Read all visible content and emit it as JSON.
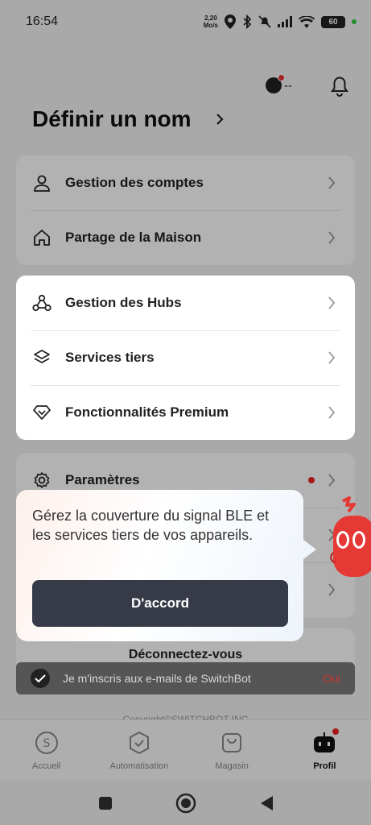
{
  "status_bar": {
    "time": "16:54",
    "speed_value": "2,20",
    "speed_unit": "Mo/s",
    "battery": "60"
  },
  "header": {
    "energy_value": "--"
  },
  "profile": {
    "name": "Définir un nom"
  },
  "card_account": [
    {
      "label": "Gestion des comptes",
      "icon": "user-icon"
    },
    {
      "label": "Partage de la Maison",
      "icon": "home-icon"
    }
  ],
  "card_services": [
    {
      "label": "Gestion des Hubs",
      "icon": "hub-icon"
    },
    {
      "label": "Services tiers",
      "icon": "layers-icon"
    },
    {
      "label": "Fonctionnalités Premium",
      "icon": "diamond-icon"
    }
  ],
  "card_settings": [
    {
      "label": "Paramètres",
      "icon": "gear-icon"
    }
  ],
  "logout": {
    "label": "Déconnectez-vous"
  },
  "email_banner": {
    "text": "Je m'inscris aux e-mails de SwitchBot",
    "action": "Oui"
  },
  "copyright": "Copyright©SWITCHBOT INC",
  "tooltip": {
    "message": "Gérez la couverture du signal BLE et les services tiers de vos appareils.",
    "button": "D'accord"
  },
  "tabs": [
    {
      "label": "Accueil",
      "icon": "home-s-icon",
      "active": false
    },
    {
      "label": "Automatisation",
      "icon": "automation-icon",
      "active": false
    },
    {
      "label": "Magasin",
      "icon": "shop-bag-icon",
      "active": false
    },
    {
      "label": "Profil",
      "icon": "robot-icon",
      "active": true
    }
  ],
  "colors": {
    "accent_dark": "#373b47",
    "badge_red": "#e22222",
    "mascot_red": "#e53935"
  }
}
